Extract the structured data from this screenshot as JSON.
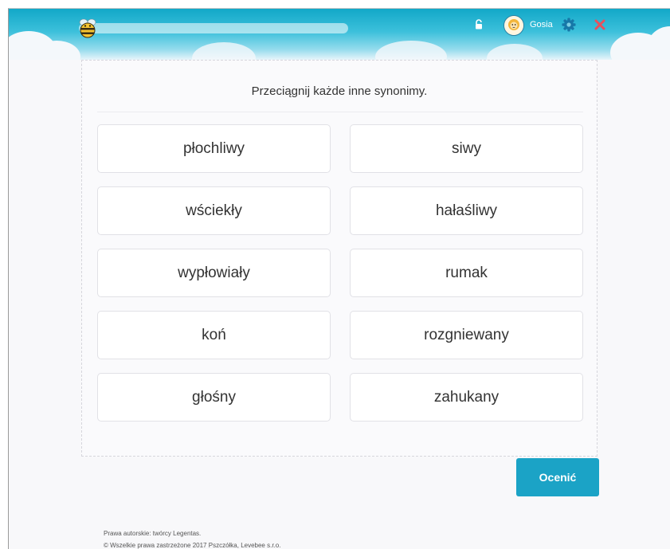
{
  "header": {
    "username": "Gosia",
    "progress": 0
  },
  "exercise": {
    "instruction": "Przeciągnij każde inne synonimy.",
    "words": [
      "płochliwy",
      "siwy",
      "wściekły",
      "hałaśliwy",
      "wypłowiały",
      "rumak",
      "koń",
      "rozgniewany",
      "głośny",
      "zahukany"
    ]
  },
  "actions": {
    "assess_label": "Ocenić"
  },
  "footer": {
    "copyright_line1": "Prawa autorskie: twórcy Legentas.",
    "copyright_line2": "© Wszelkie prawa zastrzeżone 2017 Pszczółka, Levebee s.r.o."
  },
  "colors": {
    "header_top": "#12a8c8",
    "button": "#1ba3c6",
    "close": "#e8505b",
    "gear": "#1678a8"
  },
  "icons": [
    "bee-logo-icon",
    "lock-icon",
    "avatar-icon",
    "gear-icon",
    "close-icon"
  ]
}
